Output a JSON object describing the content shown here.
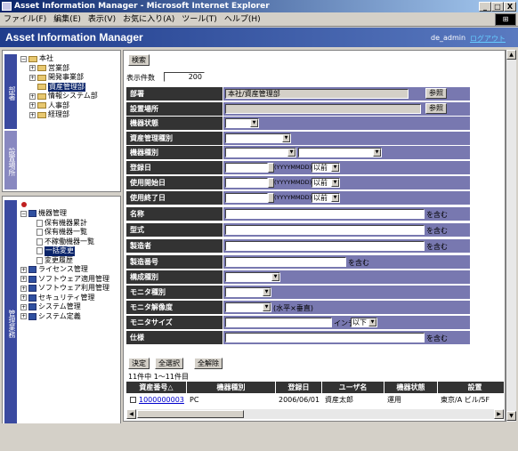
{
  "window": {
    "title": "Asset Information Manager - Microsoft Internet Explorer",
    "min": "_",
    "max": "□",
    "close": "X"
  },
  "menu": [
    "ファイル(F)",
    "編集(E)",
    "表示(V)",
    "お気に入り(A)",
    "ツール(T)",
    "ヘルプ(H)"
  ],
  "header": {
    "title": "Asset Information Manager",
    "user": "de_admin",
    "logout": "ログアウト"
  },
  "left": {
    "tab_top": "部署",
    "tab_mid": "設置場所",
    "tab_bottom": "管理業務",
    "dept_tree": [
      {
        "label": "本社",
        "kind": "root"
      },
      {
        "label": "営業部",
        "kind": "folder",
        "pm": "+"
      },
      {
        "label": "開発事業部",
        "kind": "folder",
        "pm": "+"
      },
      {
        "label": "資産管理部",
        "kind": "folder",
        "pm": "",
        "selected": true
      },
      {
        "label": "情報システム部",
        "kind": "folder",
        "pm": "+"
      },
      {
        "label": "人事部",
        "kind": "folder",
        "pm": "+"
      },
      {
        "label": "経理部",
        "kind": "folder",
        "pm": "+"
      }
    ],
    "task_tree": [
      {
        "label": "機器管理",
        "kind": "book",
        "pm": "−",
        "level": 0
      },
      {
        "label": "保有機器累計",
        "kind": "doc",
        "level": 1
      },
      {
        "label": "保有機器一覧",
        "kind": "doc",
        "level": 1
      },
      {
        "label": "不稼働機器一覧",
        "kind": "doc",
        "level": 1
      },
      {
        "label": "一括変更",
        "kind": "doc",
        "level": 1,
        "selected": true
      },
      {
        "label": "変更履歴",
        "kind": "doc",
        "level": 1
      },
      {
        "label": "ライセンス管理",
        "kind": "book",
        "pm": "+",
        "level": 0
      },
      {
        "label": "ソフトウェア適用管理",
        "kind": "book",
        "pm": "+",
        "level": 0
      },
      {
        "label": "ソフトウェア利用管理",
        "kind": "book",
        "pm": "+",
        "level": 0
      },
      {
        "label": "セキュリティ管理",
        "kind": "book",
        "pm": "+",
        "level": 0
      },
      {
        "label": "システム管理",
        "kind": "book",
        "pm": "+",
        "level": 0
      },
      {
        "label": "システム定義",
        "kind": "book",
        "pm": "+",
        "level": 0
      }
    ]
  },
  "search": {
    "button": "検索",
    "count_label": "表示件数",
    "count_value": "200"
  },
  "form": {
    "dept_label": "部署",
    "dept_value": "本社/資産管理部",
    "browse": "参照",
    "location_label": "設置場所",
    "location_value": "",
    "status_label": "機器状態",
    "mgmt_label": "資産管理種別",
    "type_label": "機器種別",
    "reg_label": "登録日",
    "date_fmt": "(YYYYMMDD)",
    "before": "以前",
    "start_label": "使用開始日",
    "end_label": "使用終了日",
    "name_label": "名称",
    "contains": "を含む",
    "model_label": "型式",
    "maker_label": "製造者",
    "serial_label": "製造番号",
    "config_label": "構成種別",
    "monitor_type_label": "モニタ種別",
    "resolution_label": "モニタ解像度",
    "resolution_note": "(水平×垂直)",
    "size_label": "モニタサイズ",
    "inch": "インチ",
    "below": "以下",
    "spec_label": "仕様"
  },
  "actions": {
    "decide": "決定",
    "select_all": "全選択",
    "deselect_all": "全解除"
  },
  "results": {
    "summary": "11件中 1～11件目",
    "columns": [
      "資産番号△",
      "機器種別",
      "登録日",
      "ユーザ名",
      "機器状態",
      "設置"
    ],
    "rows": [
      [
        "1000000003",
        "PC",
        "2006/06/01",
        "資産太郎",
        "運用",
        "東京/A ビル/5F"
      ]
    ]
  }
}
